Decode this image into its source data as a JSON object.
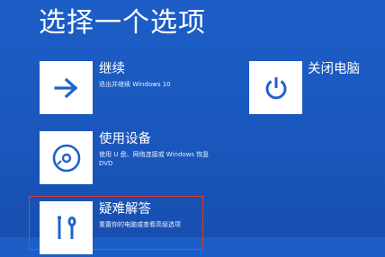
{
  "page": {
    "title": "选择一个选项"
  },
  "options": {
    "continue": {
      "title": "继续",
      "description": "退出并继续 Windows 10",
      "icon": "arrow-right-icon"
    },
    "device": {
      "title": "使用设备",
      "description": "使用 U 盘、网络连接或 Windows 恢复 DVD",
      "icon": "disc-icon"
    },
    "troubleshoot": {
      "title": "疑难解答",
      "description": "重置你的电脑或查看高级选项",
      "icon": "tools-icon"
    },
    "power": {
      "title": "关闭电脑",
      "icon": "power-icon"
    }
  },
  "colors": {
    "background": "#1a57bd",
    "tile_icon": "#1f63c9",
    "highlight": "#e23a2c"
  }
}
